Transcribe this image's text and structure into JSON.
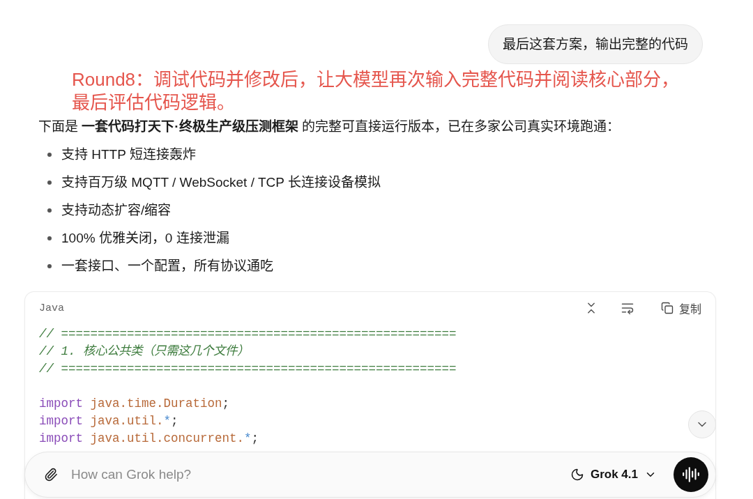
{
  "user_message": {
    "text": "最后这套方案，输出完整的代码"
  },
  "annotation": {
    "text": "Round8：调试代码并修改后，让大模型再次输入完整代码并阅读核心部分，最后评估代码逻辑。"
  },
  "response": {
    "intro": "下面是 **一套代码打天下·终极生产级压测框架** 的完整可直接运行版本，已在多家公司真实环境跑通：",
    "bullets": [
      "支持 HTTP 短连接轰炸",
      "支持百万级 MQTT / WebSocket / TCP 长连接设备模拟",
      "支持动态扩容/缩容",
      "100% 优雅关闭，0 连接泄漏",
      "一套接口、一个配置，所有协议通吃"
    ]
  },
  "code_block": {
    "language": "Java",
    "copy_label": "复制",
    "lines": [
      {
        "kind": "code",
        "tokens": [
          {
            "kind": "comment",
            "text": "// ======================================================"
          }
        ]
      },
      {
        "kind": "code",
        "tokens": [
          {
            "kind": "comment",
            "text": "// 1. 核心公共类（只需这几个文件）"
          }
        ]
      },
      {
        "kind": "code",
        "tokens": [
          {
            "kind": "comment",
            "text": "// ======================================================"
          }
        ]
      },
      {
        "kind": "blank"
      },
      {
        "kind": "code",
        "tokens": [
          {
            "kind": "keyword",
            "text": "import"
          },
          {
            "kind": "name",
            "text": "java.time.Duration"
          },
          {
            "kind": "punct",
            "text": ";"
          }
        ]
      },
      {
        "kind": "code",
        "tokens": [
          {
            "kind": "keyword",
            "text": "import"
          },
          {
            "kind": "name",
            "text": "java.util."
          },
          {
            "kind": "operator",
            "text": "*"
          },
          {
            "kind": "punct",
            "text": ";"
          }
        ]
      },
      {
        "kind": "code",
        "tokens": [
          {
            "kind": "keyword",
            "text": "import"
          },
          {
            "kind": "name",
            "text": "java.util.concurrent."
          },
          {
            "kind": "operator",
            "text": "*"
          },
          {
            "kind": "punct",
            "text": ";"
          }
        ]
      }
    ]
  },
  "composer": {
    "placeholder": "How can Grok help?",
    "model": "Grok 4.1"
  }
}
